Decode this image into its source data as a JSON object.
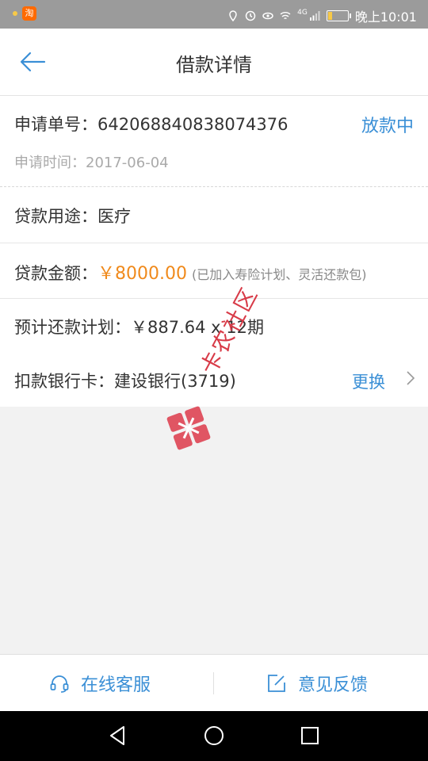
{
  "status_bar": {
    "app_badge": "淘",
    "time": "晚上10:01",
    "network": "4G"
  },
  "header": {
    "title": "借款详情"
  },
  "loan": {
    "order_label": "申请单号：",
    "order_no": "642068840838074376",
    "status": "放款中",
    "apply_time_label": "申请时间：",
    "apply_time": "2017-06-04",
    "purpose_label": "贷款用途：",
    "purpose": "医疗",
    "amount_label": "贷款金额：",
    "amount": "￥8000.00",
    "amount_note": "(已加入寿险计划、灵活还款包)",
    "plan_label": "预计还款计划：",
    "plan": "￥887.64 x 12期",
    "bank_label": "扣款银行卡：",
    "bank": "建设银行(3719)",
    "change_label": "更换"
  },
  "watermark": {
    "text": "卡农社区"
  },
  "bottom_bar": {
    "service_label": "在线客服",
    "feedback_label": "意见反馈"
  },
  "colors": {
    "accent_blue": "#3a8fd6",
    "amount_orange": "#f08a1c"
  }
}
